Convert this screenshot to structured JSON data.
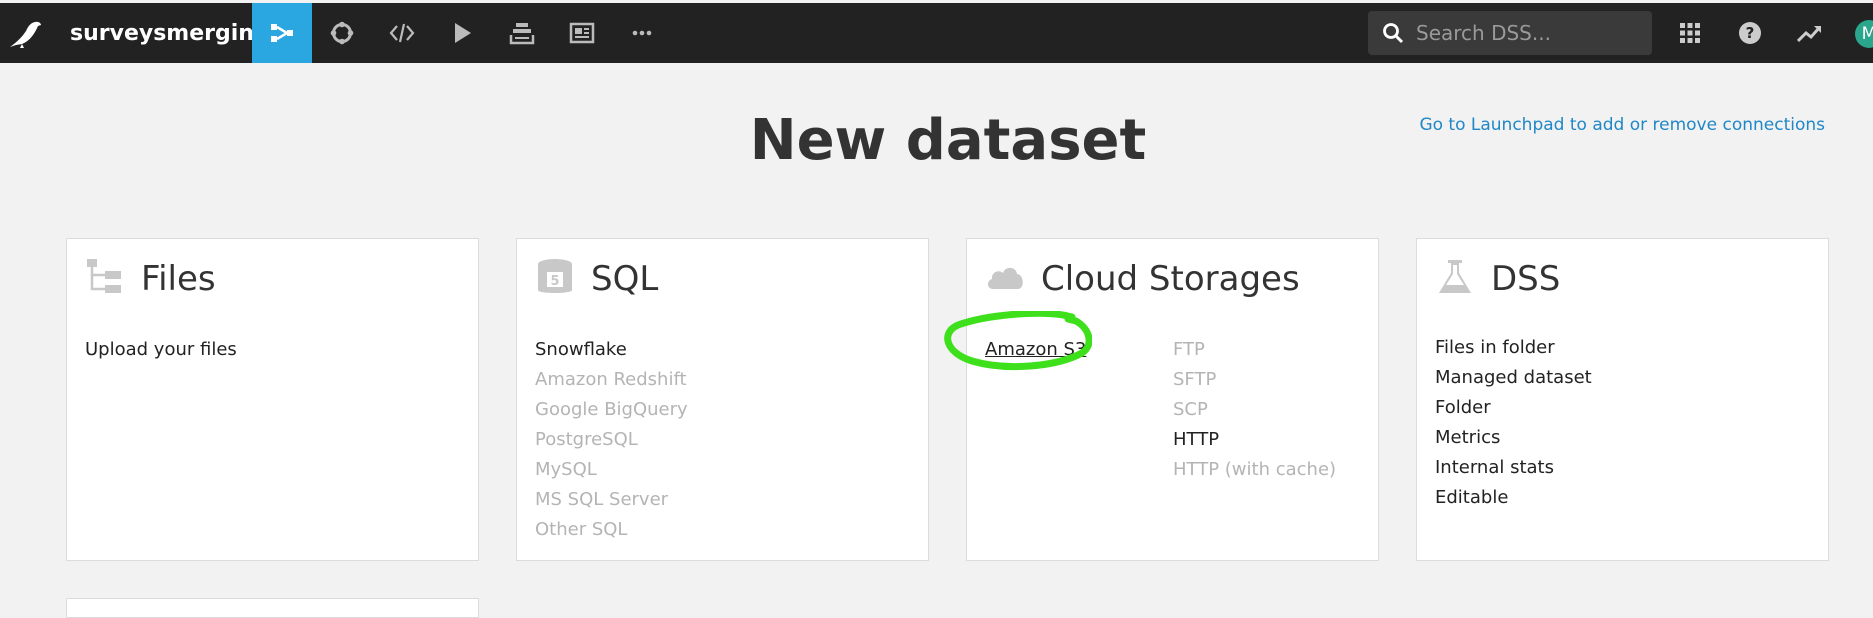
{
  "topbar": {
    "project_name": "surveysmerging",
    "search_placeholder": "Search DSS...",
    "avatar_initial": "M",
    "accent_color": "#2aa7e0",
    "nav_icons": [
      "flow-icon",
      "recipes-icon",
      "code-icon",
      "play-icon",
      "stack-icon",
      "dashboard-icon",
      "more-icon"
    ],
    "right_icons": [
      "apps-grid-icon",
      "help-icon",
      "trend-icon"
    ]
  },
  "main": {
    "title": "New dataset",
    "launchpad_link": "Go to Launchpad to add or remove connections"
  },
  "cards": {
    "files": {
      "title": "Files",
      "icon": "folder-tree-icon",
      "items": [
        {
          "label": "Upload your files",
          "enabled": true
        }
      ]
    },
    "sql": {
      "title": "SQL",
      "icon": "database-icon",
      "items": [
        {
          "label": "Snowflake",
          "enabled": true
        },
        {
          "label": "Amazon Redshift",
          "enabled": false
        },
        {
          "label": "Google BigQuery",
          "enabled": false
        },
        {
          "label": "PostgreSQL",
          "enabled": false
        },
        {
          "label": "MySQL",
          "enabled": false
        },
        {
          "label": "MS SQL Server",
          "enabled": false
        },
        {
          "label": "Other SQL",
          "enabled": false
        }
      ]
    },
    "cloud": {
      "title": "Cloud Storages",
      "icon": "cloud-icon",
      "left_items": [
        {
          "label": "Amazon S3",
          "enabled": true,
          "highlighted": true
        }
      ],
      "right_items": [
        {
          "label": "FTP",
          "enabled": false
        },
        {
          "label": "SFTP",
          "enabled": false
        },
        {
          "label": "SCP",
          "enabled": false
        },
        {
          "label": "HTTP",
          "enabled": true
        },
        {
          "label": "HTTP (with cache)",
          "enabled": false
        }
      ]
    },
    "dss": {
      "title": "DSS",
      "icon": "flask-icon",
      "items": [
        {
          "label": "Files in folder",
          "enabled": true
        },
        {
          "label": "Managed dataset",
          "enabled": true
        },
        {
          "label": "Folder",
          "enabled": true
        },
        {
          "label": "Metrics",
          "enabled": true
        },
        {
          "label": "Internal stats",
          "enabled": true
        },
        {
          "label": "Editable",
          "enabled": true
        }
      ]
    }
  },
  "annotation": {
    "color": "#3ee01c",
    "target": "Amazon S3"
  }
}
